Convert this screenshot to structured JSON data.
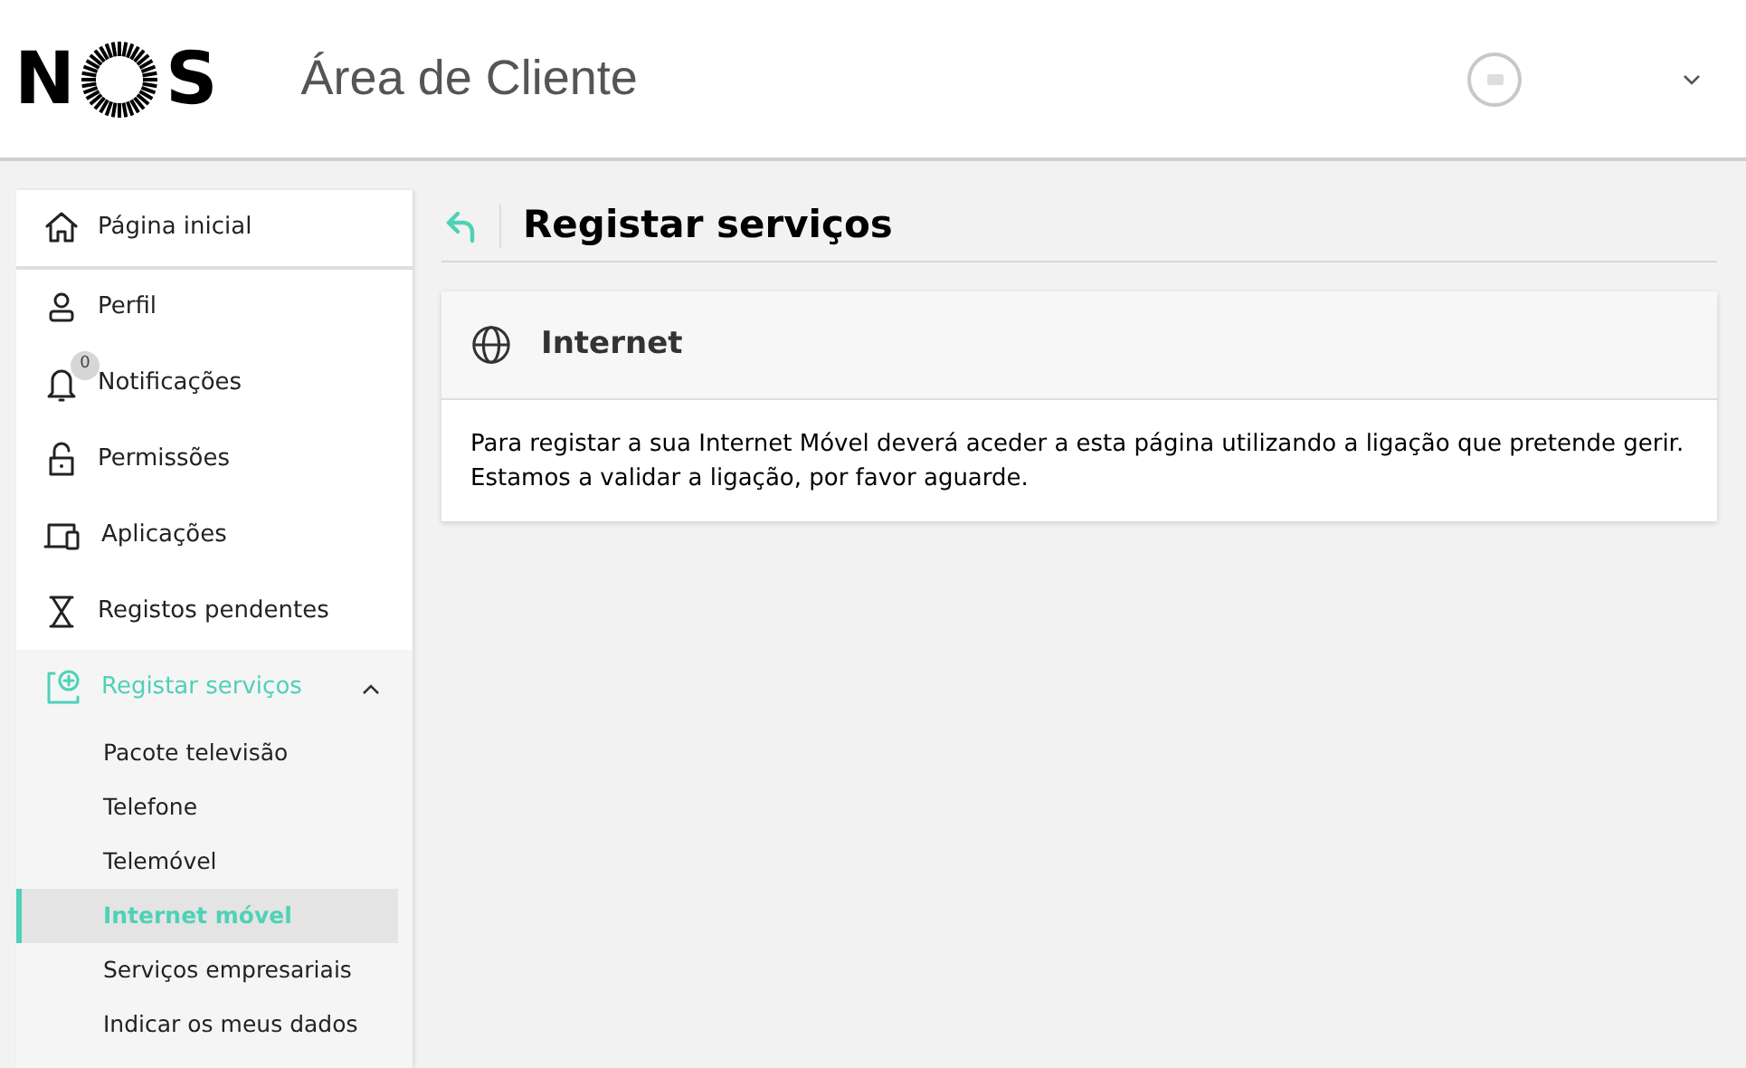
{
  "header": {
    "logo": {
      "left": "N",
      "right": "S"
    },
    "title": "Área de Cliente"
  },
  "sidebar": {
    "items": [
      {
        "label": "Página inicial",
        "selected": false
      },
      {
        "label": "Perfil",
        "selected": false
      },
      {
        "label": "Notificações",
        "badge": "0",
        "selected": false
      },
      {
        "label": "Permissões",
        "selected": false
      },
      {
        "label": "Aplicações",
        "selected": false
      },
      {
        "label": "Registos pendentes",
        "selected": false
      },
      {
        "label": "Registar serviços",
        "selected": true,
        "expanded": true,
        "children": [
          {
            "label": "Pacote televisão",
            "selected": false
          },
          {
            "label": "Telefone",
            "selected": false
          },
          {
            "label": "Telemóvel",
            "selected": false
          },
          {
            "label": "Internet móvel",
            "selected": true
          },
          {
            "label": "Serviços empresariais",
            "selected": false
          },
          {
            "label": "Indicar os meus dados",
            "selected": false
          }
        ]
      }
    ]
  },
  "page": {
    "title": "Registar serviços",
    "card": {
      "title": "Internet",
      "lines": [
        "Para registar a sua Internet Móvel deverá aceder a esta página utilizando a ligação que pretende gerir.",
        "Estamos a validar a ligação, por favor aguarde."
      ]
    }
  }
}
